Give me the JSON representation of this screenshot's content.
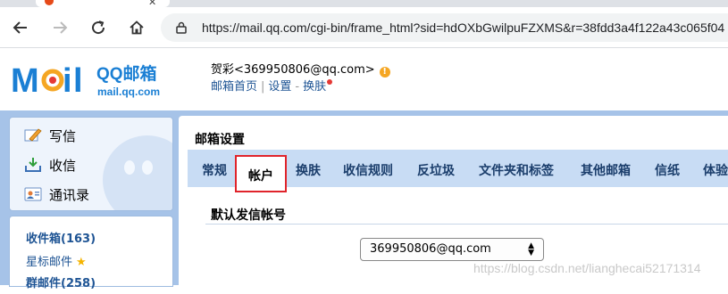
{
  "browser": {
    "url": "https://mail.qq.com/cgi-bin/frame_html?sid=hdOXbGwilpuFZXMS&r=38fdd3a4f122a43c065f04"
  },
  "header": {
    "logo_text_main": "QQ邮箱",
    "logo_text_domain": "mail.qq.com",
    "user_name": "贺彩<369950806@qq.com>",
    "links": [
      "邮箱首页",
      "设置",
      "换肤"
    ]
  },
  "sidebar": {
    "actions": [
      {
        "label": "写信",
        "icon": "pencil-icon"
      },
      {
        "label": "收信",
        "icon": "inbox-download-icon"
      },
      {
        "label": "通讯录",
        "icon": "contacts-icon"
      }
    ],
    "folders": [
      {
        "label": "收件箱(163)"
      },
      {
        "label": "星标邮件"
      },
      {
        "label": "群邮件(258)"
      }
    ]
  },
  "settings": {
    "title": "邮箱设置",
    "tabs": [
      "常规",
      "帐户",
      "换肤",
      "收信规则",
      "反垃圾",
      "文件夹和标签",
      "其他邮箱",
      "信纸",
      "体验"
    ],
    "active_tab": "帐户",
    "section_title": "默认发信帐号",
    "default_sender": "369950806@qq.com"
  },
  "watermark": "https://blog.csdn.net/lianghecai52171314",
  "colors": {
    "frame_blue": "#a6c3e8",
    "tabbar_blue": "#c8dcf4",
    "active_tab_border": "#e0242b",
    "link_blue": "#1e5494"
  }
}
